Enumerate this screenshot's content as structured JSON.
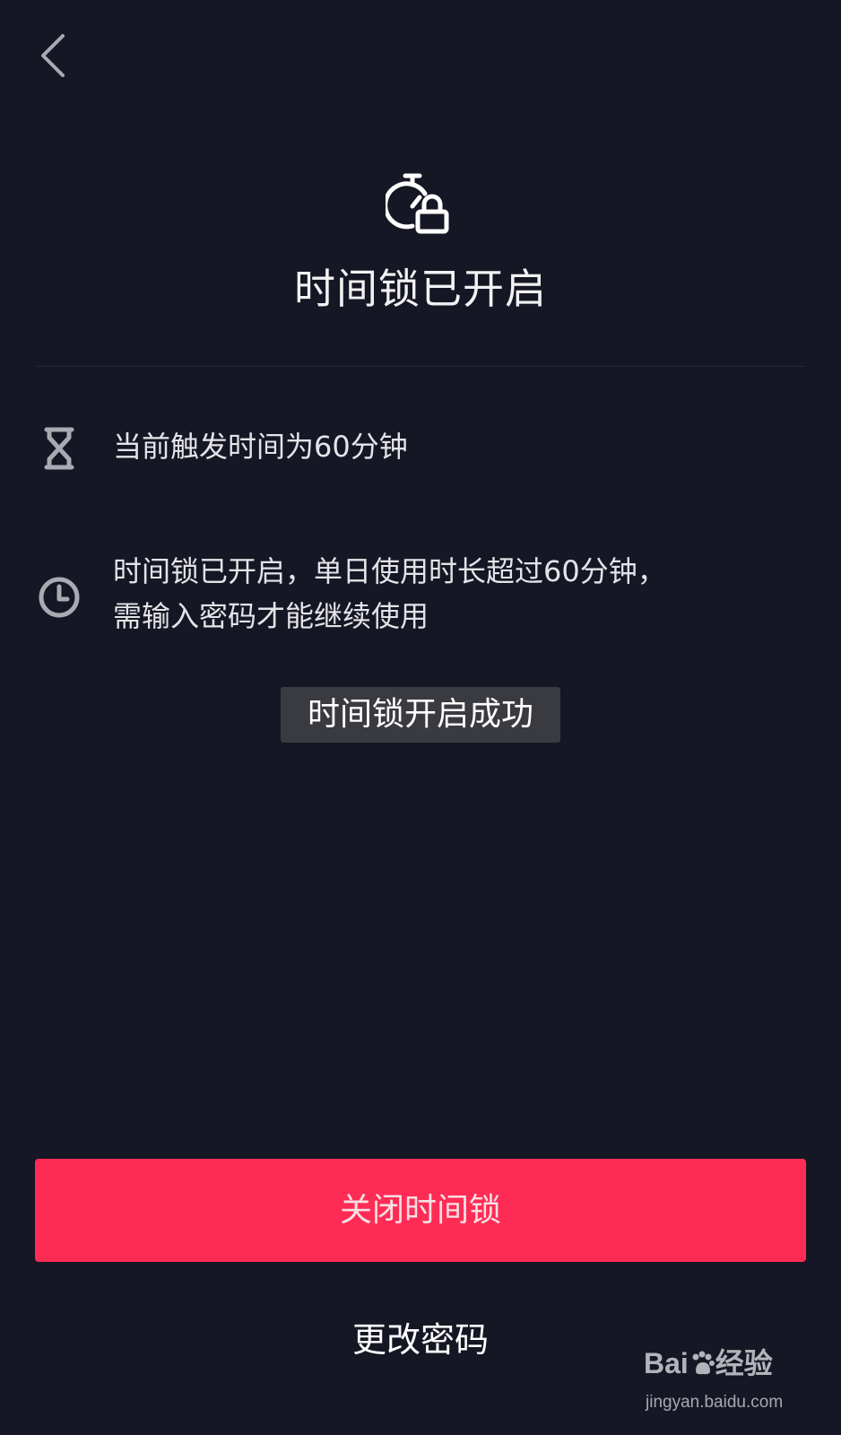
{
  "header": {
    "back_icon": "chevron-left-icon"
  },
  "hero": {
    "icon": "stopwatch-lock-icon",
    "title": "时间锁已开启"
  },
  "info": [
    {
      "icon": "hourglass-icon",
      "text": "当前触发时间为60分钟"
    },
    {
      "icon": "clock-icon",
      "text_line1": "时间锁已开启，单日使用时长超过60分钟，",
      "text_line2": "需输入密码才能继续使用"
    }
  ],
  "toast": {
    "text": "时间锁开启成功"
  },
  "actions": {
    "primary_label": "关闭时间锁",
    "secondary_label": "更改密码"
  },
  "watermark": {
    "brand_left": "Bai",
    "brand_right": "经验",
    "url": "jingyan.baidu.com"
  },
  "colors": {
    "background": "#161724",
    "primary_button": "#fe2c55",
    "toast_background": "#3a3b41",
    "icon_gray": "#a9aab2"
  }
}
